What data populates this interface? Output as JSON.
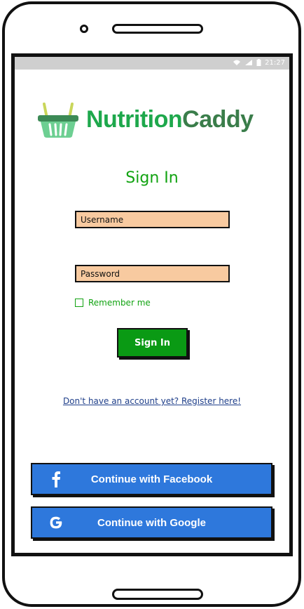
{
  "status_bar": {
    "time": "21:27",
    "icons": [
      "wifi-icon",
      "signal-icon",
      "battery-icon"
    ]
  },
  "brand": {
    "part_a": "Nutrition",
    "part_b": "Caddy",
    "logo_icon": "basket-icon",
    "color_a": "#1ea84c",
    "color_b": "#3a7d4a"
  },
  "signin": {
    "title": "Sign In",
    "username_placeholder": "Username",
    "password_placeholder": "Password",
    "remember_label": "Remember me",
    "remember_checked": false,
    "button_label": "Sign In",
    "button_color": "#0a9a14"
  },
  "register": {
    "link_text": "Don't have an account yet? Register here!"
  },
  "social": {
    "facebook_label": "Continue with Facebook",
    "google_label": "Continue with Google",
    "button_color": "#2e78dc",
    "facebook_icon": "facebook-icon",
    "google_icon": "google-icon"
  },
  "colors": {
    "input_fill": "#f8caa0",
    "accent_text": "#12a312",
    "link": "#1f3f8a"
  }
}
